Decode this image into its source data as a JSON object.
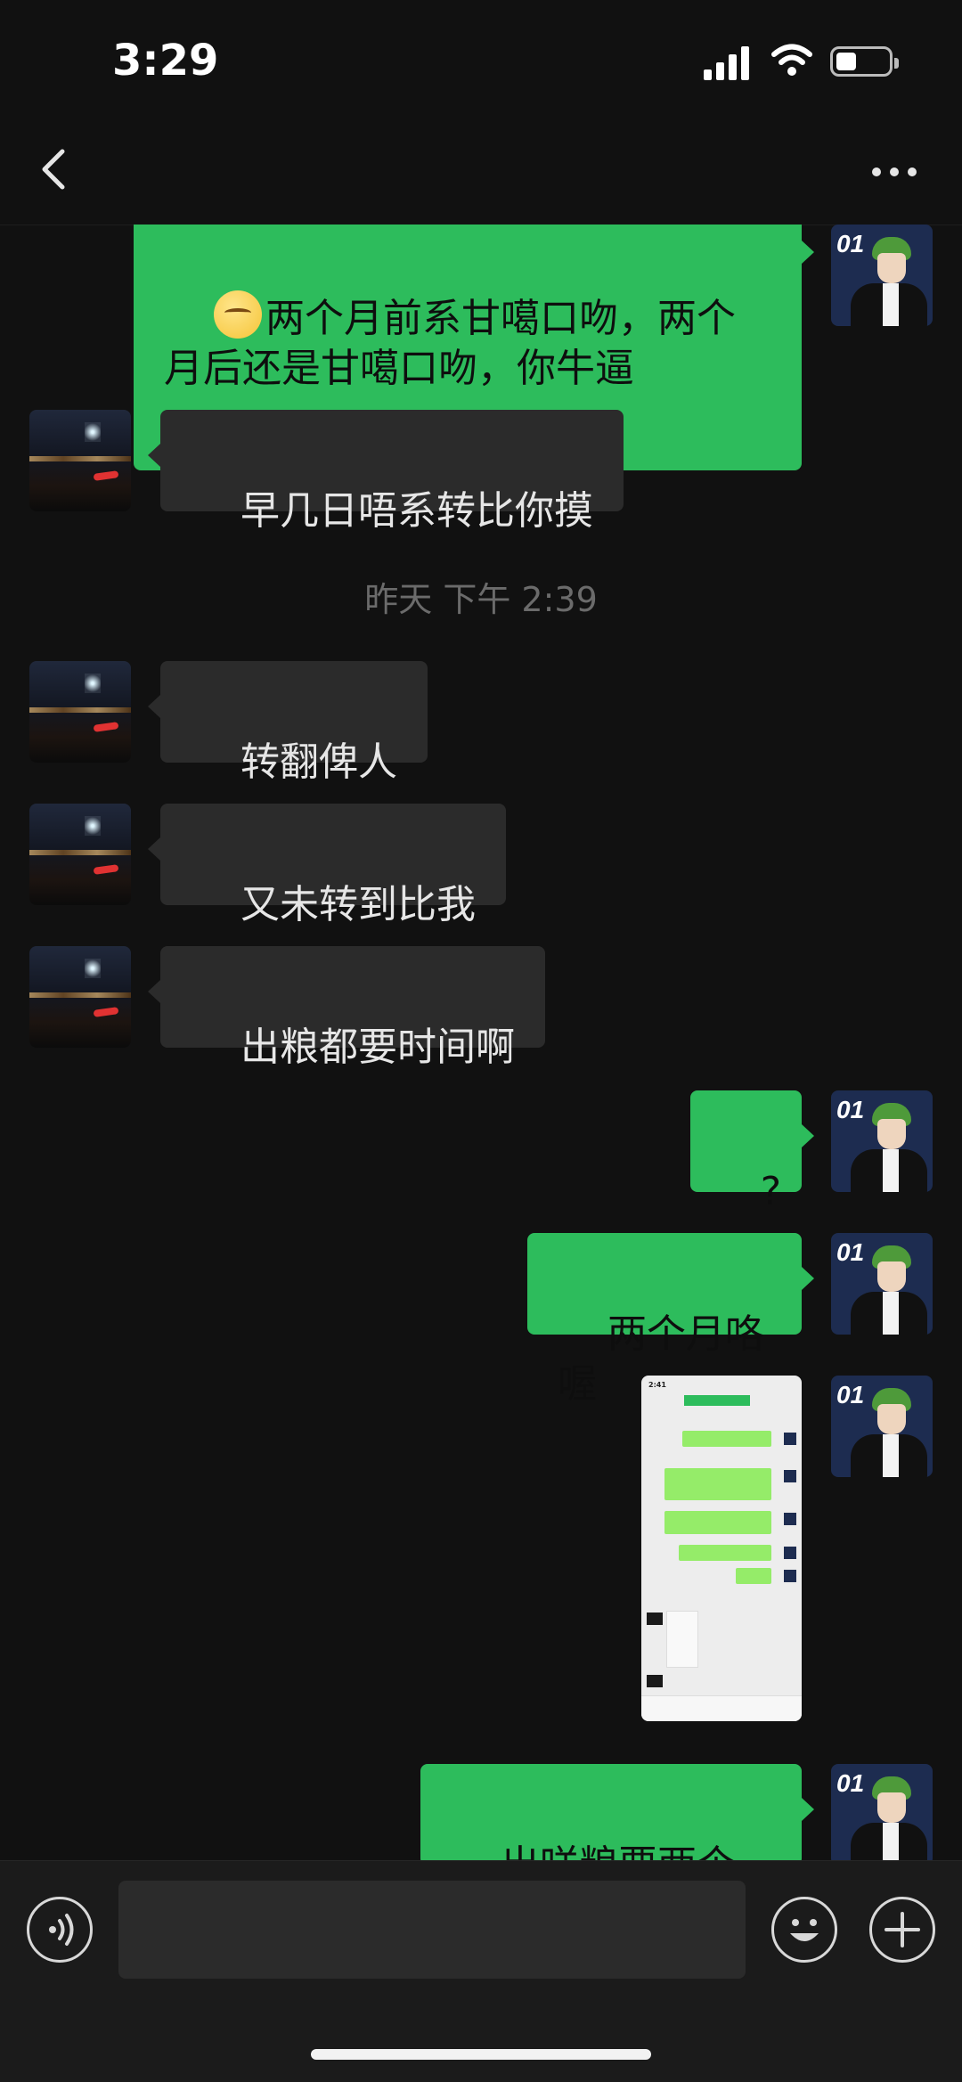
{
  "status_bar": {
    "time": "3:29"
  },
  "header": {
    "back_icon": "chevron-left-icon",
    "more_icon": "more-dots-icon"
  },
  "messages": [
    {
      "side": "right",
      "text": "两个月前系甘噶口吻，两个月后还是甘噶口吻，你牛逼",
      "emoji": "smirking-face-emoji"
    },
    {
      "side": "left",
      "text": "早几日唔系转比你摸"
    },
    {
      "type": "timestamp",
      "text": "昨天 下午 2:39"
    },
    {
      "side": "left",
      "text": "转翻俾人"
    },
    {
      "side": "left",
      "text": "又未转到比我"
    },
    {
      "side": "left",
      "text": "出粮都要时间啊"
    },
    {
      "side": "right",
      "text": "?"
    },
    {
      "side": "right",
      "text": "两个月咯喔"
    },
    {
      "side": "right",
      "type": "image",
      "thumb_time": "2:41"
    },
    {
      "side": "right",
      "text": "出咩粮要两个月?"
    }
  ],
  "input_bar": {
    "voice_icon": "voice-icon",
    "emoji_icon": "emoji-icon",
    "plus_icon": "plus-icon",
    "placeholder": ""
  },
  "colors": {
    "background": "#111111",
    "bubble_sent": "#2dbc5c",
    "bubble_received": "#2b2b2b",
    "timestamp": "#6b6b6b"
  }
}
